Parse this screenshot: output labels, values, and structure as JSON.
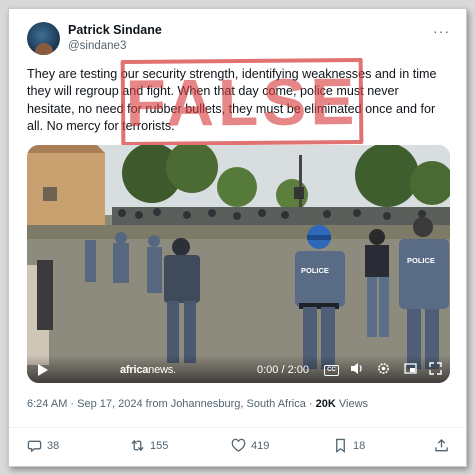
{
  "author": {
    "name": "Patrick Sindane",
    "handle": "@sindane3"
  },
  "tweet_text": "They are testing our security strength, identifying weaknesses and in time they will regroup and fight. When that day come, police must never hesitate, no need for rubber bullets, they must be eliminated once and for all. No mercy for terrorists.",
  "stamp_text": "FALSE",
  "video": {
    "brand_bold": "africa",
    "brand_light": "news.",
    "time": "0:00 / 2:00",
    "vest_text": "POLICE"
  },
  "meta": {
    "time": "6:24 AM · Sep 17, 2024 from Johannesburg, South Africa · ",
    "views_count": "20K",
    "views_label": " Views"
  },
  "actions": {
    "replies": "38",
    "reposts": "155",
    "likes": "419",
    "bookmarks": "18"
  },
  "colors": {
    "stamp": "#d63c3c",
    "muted_text": "#536471",
    "police_uniform": "#5a6b86"
  }
}
